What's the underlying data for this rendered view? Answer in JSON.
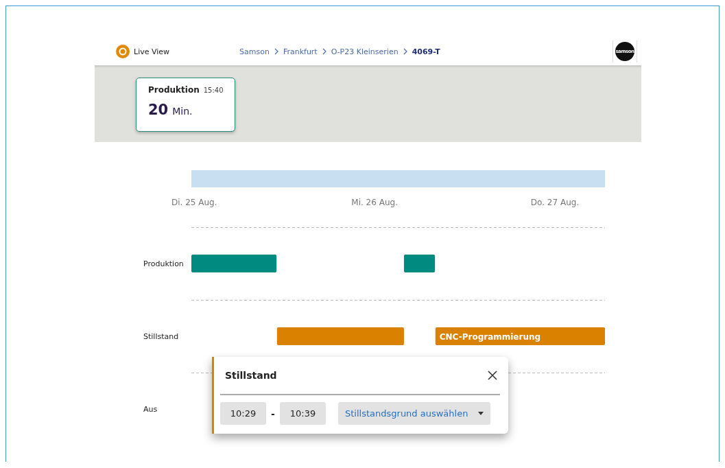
{
  "header": {
    "app_title": "Live View",
    "breadcrumb": [
      {
        "label": "Samson",
        "current": false
      },
      {
        "label": "Frankfurt",
        "current": false
      },
      {
        "label": "O-P23 Kleinserien",
        "current": false
      },
      {
        "label": "4069-T",
        "current": true
      }
    ],
    "logo": "samson"
  },
  "status_card": {
    "state": "Produktion",
    "time": "15:40",
    "value": "20",
    "unit": "Min."
  },
  "timeline": {
    "dates": [
      "Di. 25 Aug.",
      "Mi. 26 Aug.",
      "Do. 27 Aug."
    ],
    "rows": [
      {
        "label": "Produktion",
        "kind": "production"
      },
      {
        "label": "Stillstand",
        "kind": "downtime",
        "event_label": "CNC-Programmierung"
      },
      {
        "label": "Aus",
        "kind": "off"
      }
    ]
  },
  "popup": {
    "title": "Stillstand",
    "from": "10:29",
    "separator": "-",
    "to": "10:39",
    "reason_placeholder": "Stillstandsgrund auswählen"
  }
}
